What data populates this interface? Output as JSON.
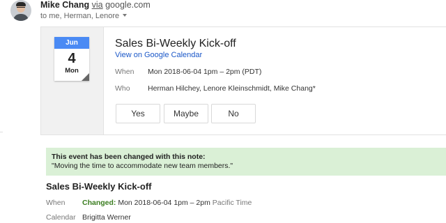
{
  "sender": {
    "name": "Mike Chang",
    "via_label": "via",
    "domain": "google.com",
    "recipients": "to me, Herman, Lenore"
  },
  "invite": {
    "month": "Jun",
    "day": "4",
    "weekday": "Mon",
    "title": "Sales Bi-Weekly Kick-off",
    "calendar_link": "View on Google Calendar",
    "when_label": "When",
    "when_value": "Mon 2018-06-04 1pm – 2pm (PDT)",
    "who_label": "Who",
    "who_value": "Herman Hilchey, Lenore Kleinschmidt, Mike Chang*",
    "rsvp": {
      "yes": "Yes",
      "maybe": "Maybe",
      "no": "No"
    },
    "month_color": "#4a8af4"
  },
  "change_note": {
    "heading": "This event has been changed with this note:",
    "text": "\"Moving the time to accommodate new team members.\"",
    "bg_color": "#daf0d6"
  },
  "details": {
    "title": "Sales Bi-Weekly Kick-off",
    "when_label": "When",
    "changed_label": "Changed:",
    "when_value": "Mon 2018-06-04 1pm – 2pm",
    "timezone": "Pacific Time",
    "calendar_label": "Calendar",
    "calendar_value": "Brigitta Werner",
    "changed_color": "#3a7d1f"
  }
}
